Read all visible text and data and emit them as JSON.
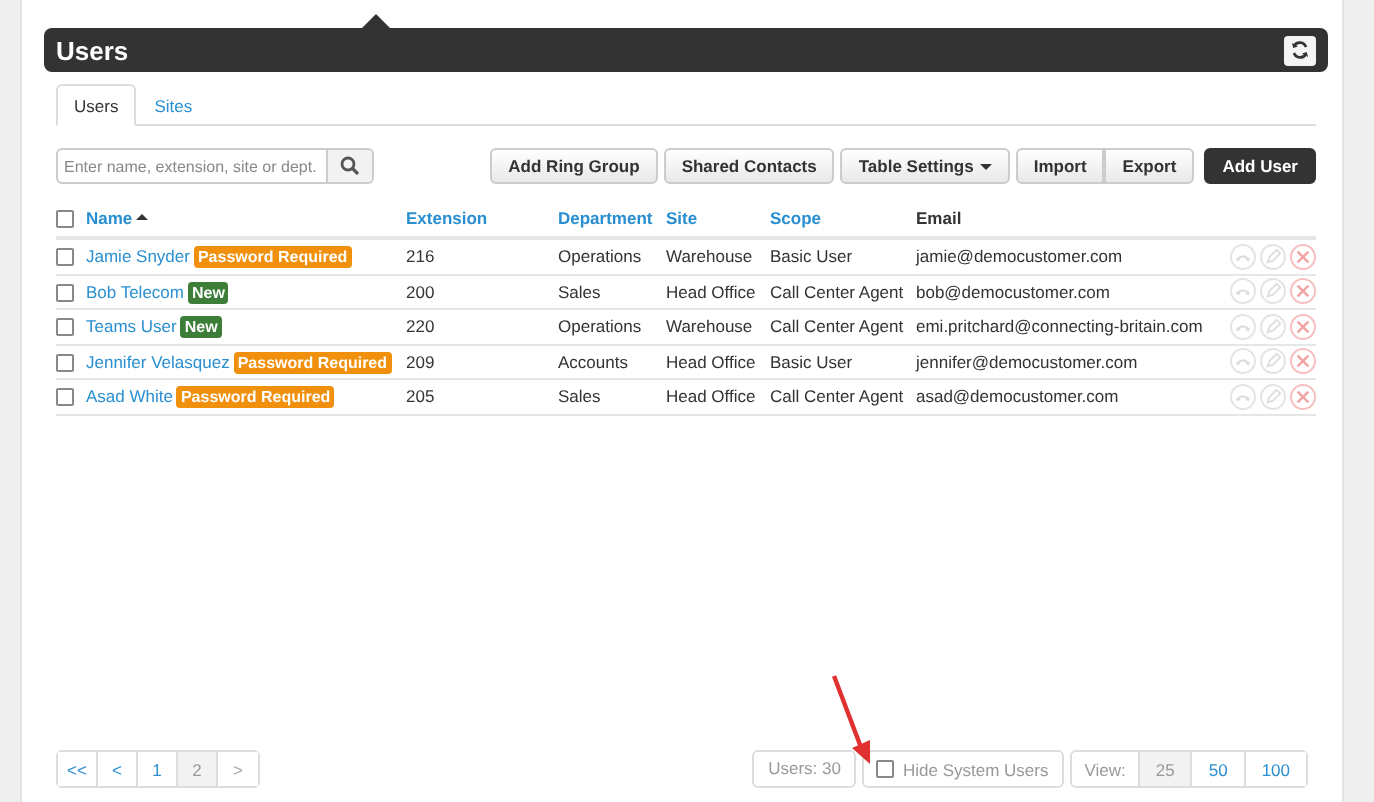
{
  "header": {
    "title": "Users"
  },
  "tabs": [
    {
      "label": "Users",
      "selected": true
    },
    {
      "label": "Sites",
      "selected": false
    }
  ],
  "search": {
    "placeholder": "Enter name, extension, site or dept."
  },
  "toolbar": [
    {
      "label": "Add Ring Group",
      "kind": "default"
    },
    {
      "label": "Shared Contacts",
      "kind": "default"
    },
    {
      "label": "Table Settings",
      "kind": "dropdown"
    },
    {
      "label": "Import",
      "kind": "default"
    },
    {
      "label": "Export",
      "kind": "default"
    },
    {
      "label": "Add User",
      "kind": "primary"
    }
  ],
  "table": {
    "select_all": {
      "checked": false
    },
    "columns": [
      {
        "label": "Name",
        "sortable": true,
        "sorted": true
      },
      {
        "label": "Extension",
        "sortable": true,
        "sorted": false
      },
      {
        "label": "Department",
        "sortable": true,
        "sorted": false
      },
      {
        "label": "Site",
        "sortable": true,
        "sorted": false
      },
      {
        "label": "Scope",
        "sortable": true,
        "sorted": false
      },
      {
        "label": "Email",
        "sortable": false,
        "sorted": false
      }
    ],
    "rows": [
      {
        "checked": false,
        "name": "Jamie Snyder",
        "badge": {
          "label": "Password Required",
          "kind": "warning"
        },
        "extension": "216",
        "department": "Operations",
        "site": "Warehouse",
        "scope": "Basic User",
        "email": "jamie@democustomer.com"
      },
      {
        "checked": false,
        "name": "Bob Telecom",
        "badge": {
          "label": "New",
          "kind": "new"
        },
        "extension": "200",
        "department": "Sales",
        "site": "Head Office",
        "scope": "Call Center Agent",
        "email": "bob@democustomer.com"
      },
      {
        "checked": false,
        "name": "Teams User",
        "badge": {
          "label": "New",
          "kind": "new"
        },
        "extension": "220",
        "department": "Operations",
        "site": "Warehouse",
        "scope": "Call Center Agent",
        "email": "emi.pritchard@connecting-britain.com"
      },
      {
        "checked": false,
        "name": "Jennifer Velasquez",
        "badge": {
          "label": "Password Required",
          "kind": "warning"
        },
        "extension": "209",
        "department": "Accounts",
        "site": "Head Office",
        "scope": "Basic User",
        "email": "jennifer@democustomer.com"
      },
      {
        "checked": false,
        "name": "Asad White",
        "badge": {
          "label": "Password Required",
          "kind": "warning"
        },
        "extension": "205",
        "department": "Sales",
        "site": "Head Office",
        "scope": "Call Center Agent",
        "email": "asad@democustomer.com"
      }
    ]
  },
  "pagination": [
    {
      "label": "<<",
      "selected": false
    },
    {
      "label": "<",
      "selected": false
    },
    {
      "label": "1",
      "selected": false
    },
    {
      "label": "2",
      "selected": true
    },
    {
      "label": ">",
      "selected": false
    }
  ],
  "user_count": "Users: 30",
  "hide_system_users": {
    "label": "Hide System Users",
    "checked": false
  },
  "view": {
    "label": "View:",
    "options": [
      {
        "label": "25",
        "selected": true
      },
      {
        "label": "50",
        "selected": false
      },
      {
        "label": "100",
        "selected": false
      }
    ]
  }
}
